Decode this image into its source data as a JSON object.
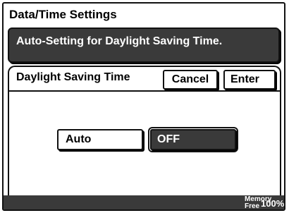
{
  "screen": {
    "title": "Data/Time Settings",
    "message": "Auto-Setting for Daylight Saving Time."
  },
  "panel": {
    "title": "Daylight Saving Time",
    "cancel_label": "Cancel",
    "enter_label": "Enter",
    "options": {
      "auto_label": "Auto",
      "off_label": "OFF",
      "selected": "OFF"
    }
  },
  "status": {
    "memory_label_line1": "Memory",
    "memory_label_line2": "Free",
    "memory_value": "100%"
  },
  "colors": {
    "dark_fill": "#3a3a3a",
    "border": "#111111",
    "background": "#ffffff"
  }
}
